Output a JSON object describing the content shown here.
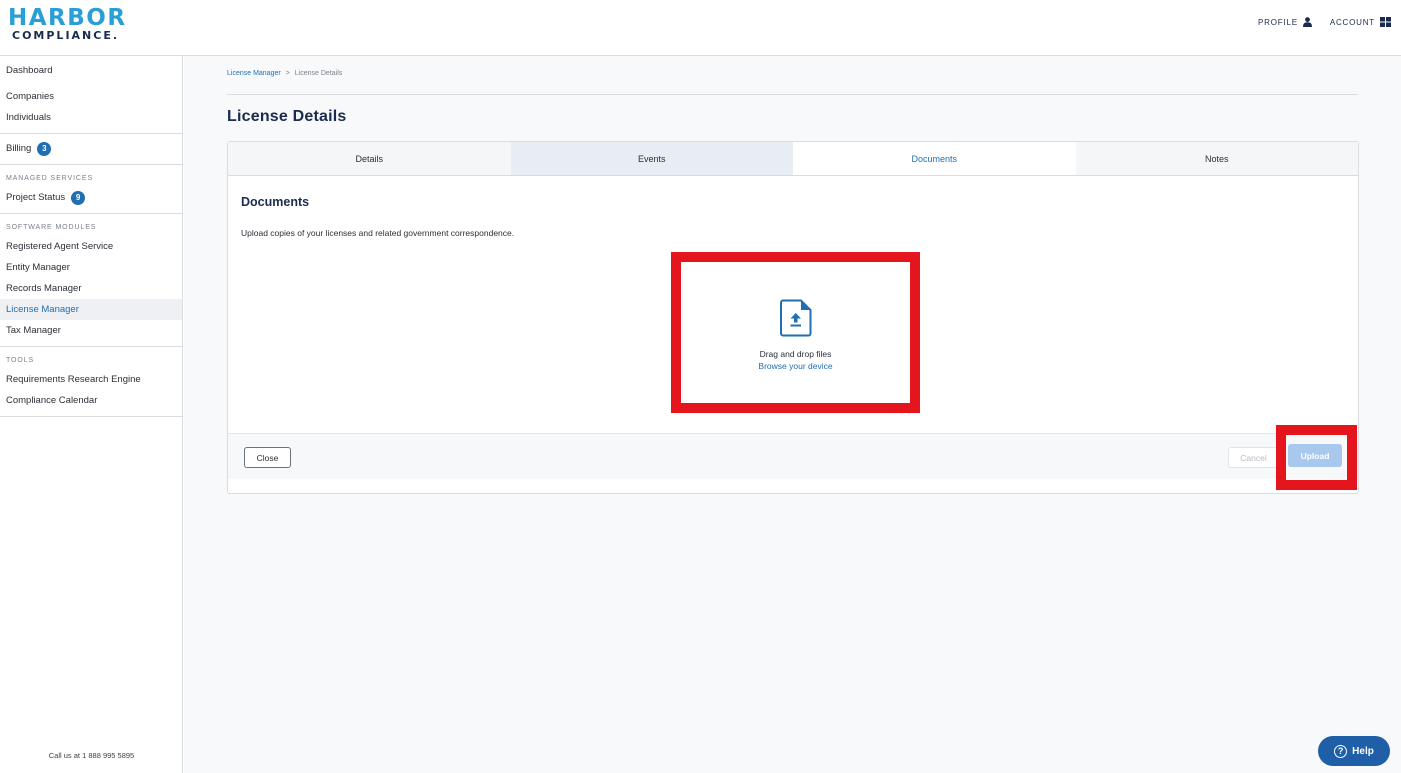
{
  "brand": {
    "line1": "HARBOR",
    "line2": "COMPLIANCE."
  },
  "header": {
    "profile_label": "PROFILE",
    "account_label": "ACCOUNT"
  },
  "sidebar": {
    "dashboard": "Dashboard",
    "companies": "Companies",
    "individuals": "Individuals",
    "billing": "Billing",
    "billing_count": "3",
    "managed_services_heading": "MANAGED SERVICES",
    "project_status": "Project Status",
    "project_status_count": "9",
    "software_modules_heading": "SOFTWARE MODULES",
    "registered_agent": "Registered Agent Service",
    "entity_manager": "Entity Manager",
    "records_manager": "Records Manager",
    "license_manager": "License Manager",
    "tax_manager": "Tax Manager",
    "tools_heading": "TOOLS",
    "requirements_engine": "Requirements Research Engine",
    "compliance_calendar": "Compliance Calendar",
    "call_us": "Call us at 1 888 995 5895"
  },
  "breadcrumb": {
    "parent": "License Manager",
    "separator": ">",
    "current": "License Details"
  },
  "page_title": "License Details",
  "tabs": [
    {
      "label": "Details"
    },
    {
      "label": "Events"
    },
    {
      "label": "Documents"
    },
    {
      "label": "Notes"
    }
  ],
  "documents": {
    "title": "Documents",
    "description": "Upload copies of your licenses and related government correspondence.",
    "drop_text": "Drag and drop files",
    "browse_text": "Browse your device"
  },
  "footer": {
    "close_label": "Close",
    "cancel_label": "Cancel",
    "upload_label": "Upload"
  },
  "help_label": "Help",
  "colors": {
    "accent": "#1f6fb2",
    "highlight": "#e4151d",
    "upload_disabled": "#a8c8ee",
    "brand_navy": "#1b2a4e",
    "brand_blue": "#2a9fd6"
  }
}
